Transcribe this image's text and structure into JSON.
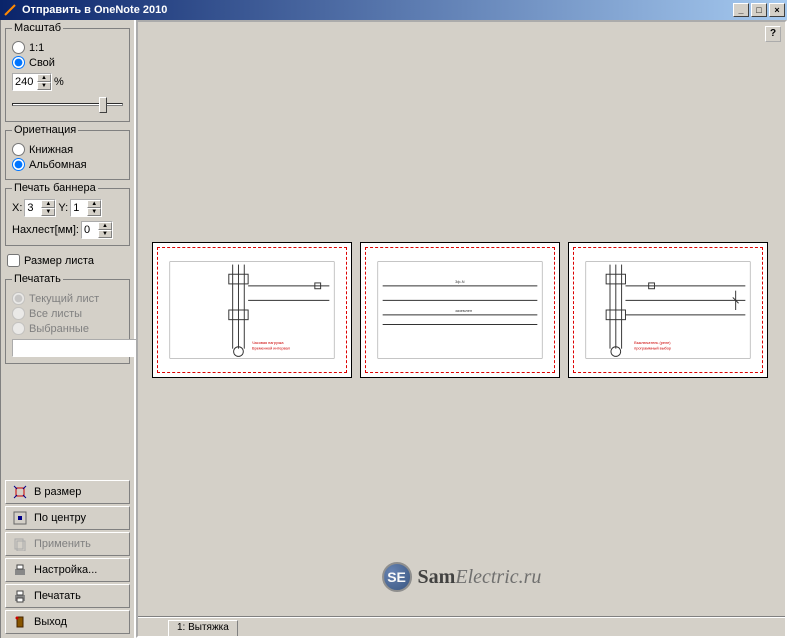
{
  "window": {
    "title": "Отправить в OneNote 2010",
    "minimize": "_",
    "maximize": "□",
    "close": "×"
  },
  "scale": {
    "legend": "Масштаб",
    "r1": "1:1",
    "r2": "Свой",
    "value": "240",
    "percent": "%"
  },
  "orient": {
    "legend": "Ориетнация",
    "r1": "Книжная",
    "r2": "Альбомная"
  },
  "banner": {
    "legend": "Печать баннера",
    "xlabel": "X:",
    "xval": "3",
    "ylabel": "Y:",
    "yval": "1",
    "overlap_label": "Нахлест[мм]:",
    "overlap_val": "0"
  },
  "sheetsize": "Размер листа",
  "print": {
    "legend": "Печатать",
    "r1": "Текущий лист",
    "r2": "Все листы",
    "r3": "Выбранные",
    "browse": "..."
  },
  "buttons": {
    "fit": "В размер",
    "center": "По центру",
    "apply": "Применить",
    "setup": "Настройка...",
    "print": "Печатать",
    "exit": "Выход"
  },
  "tab": "1: Вытяжка",
  "help": "?",
  "watermark": {
    "logo": "SE",
    "text1": "Sam",
    "text2": "Electric.ru"
  }
}
